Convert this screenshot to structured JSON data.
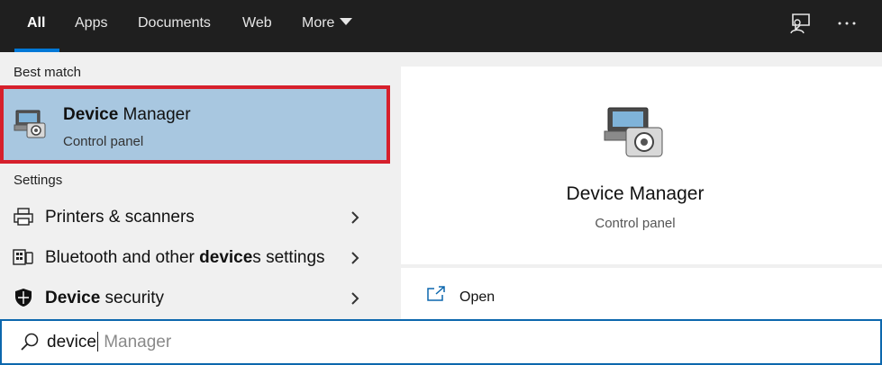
{
  "tabs": [
    {
      "label": "All",
      "active": true
    },
    {
      "label": "Apps"
    },
    {
      "label": "Documents"
    },
    {
      "label": "Web"
    },
    {
      "label": "More"
    }
  ],
  "top_icons": [
    "feedback-icon",
    "more-options-icon"
  ],
  "sections": {
    "best_match": "Best match",
    "settings": "Settings"
  },
  "best_match": {
    "title_bold": "Device",
    "title_rest": " Manager",
    "subtitle": "Control panel",
    "icon": "device-manager-icon"
  },
  "settings_items": [
    {
      "pre": "",
      "bold": "",
      "post": "Printers & scanners",
      "icon": "printer-icon"
    },
    {
      "pre": "Bluetooth and other ",
      "bold": "device",
      "post": "s settings",
      "icon": "bluetooth-devices-icon"
    },
    {
      "pre": "",
      "bold": "Device",
      "post": " security",
      "icon": "shield-icon"
    }
  ],
  "detail": {
    "title": "Device Manager",
    "subtitle": "Control panel",
    "actions": [
      {
        "label": "Open",
        "icon": "open-icon"
      }
    ]
  },
  "search": {
    "typed": "device",
    "suggestion": " Manager"
  },
  "colors": {
    "topbar": "#1f1f1f",
    "accent": "#0078d7",
    "highlight": "#a8c7e0",
    "selection_border": "#d6202c"
  }
}
